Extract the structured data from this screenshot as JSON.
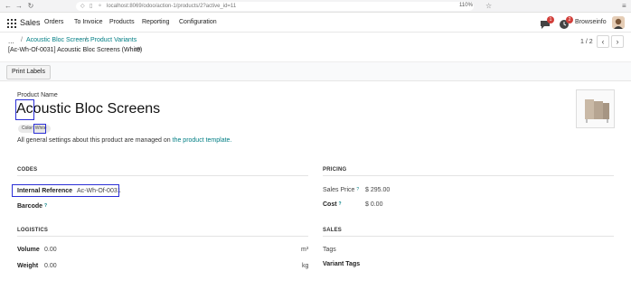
{
  "browser": {
    "url": "localhost:8069/odoo/action-1/products/2?active_id=11",
    "zoom": "110%"
  },
  "navbar": {
    "brand": "Sales",
    "menu": [
      "Orders",
      "To Invoice",
      "Products",
      "Reporting",
      "Configuration"
    ],
    "chat_count": "1",
    "activity_count": "2",
    "user": "Browseinfo"
  },
  "control": {
    "dots": "...",
    "breadcrumbs": [
      "Acoustic Bloc Screens",
      "Product Variants"
    ],
    "record_title": "[Ac-Wh-Of-0031] Acoustic Bloc Screens (White)",
    "pager": "1 / 2"
  },
  "actions": {
    "print_labels": "Print Labels"
  },
  "form": {
    "product_name_label": "Product Name",
    "product_name": "Acoustic Bloc Screens",
    "attribute_tag": "Color: White",
    "note_prefix": "All general settings about this product are managed on",
    "note_link": "the product template.",
    "codes": {
      "title": "CODES",
      "internal_ref_label": "Internal Reference",
      "internal_ref_value": "Ac-Wh-Of-0031",
      "barcode_label": "Barcode",
      "barcode_help": "?"
    },
    "pricing": {
      "title": "PRICING",
      "sales_price_label": "Sales Price",
      "sales_price_help": "?",
      "sales_price_value": "$ 295.00",
      "cost_label": "Cost",
      "cost_help": "?",
      "cost_value": "$ 0.00"
    },
    "logistics": {
      "title": "LOGISTICS",
      "volume_label": "Volume",
      "volume_value": "0.00",
      "volume_unit": "m³",
      "weight_label": "Weight",
      "weight_value": "0.00",
      "weight_unit": "kg"
    },
    "sales": {
      "title": "SALES",
      "tags_label": "Tags",
      "variant_tags_label": "Variant Tags"
    }
  },
  "colors": {
    "accent": "#017e84",
    "highlight": "#2b2fd6",
    "badge": "#d23f3a"
  }
}
